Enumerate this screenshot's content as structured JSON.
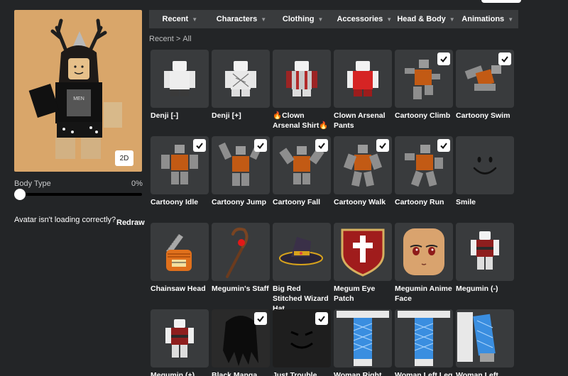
{
  "avatar": {
    "view_toggle_label": "2D",
    "body_type_label": "Body Type",
    "body_type_value": "0%",
    "body_type_fraction": 0,
    "loading_issue_text": "Avatar isn't loading correctly?",
    "redraw_label": "Redraw"
  },
  "tabs": [
    {
      "label": "Recent",
      "icon": "chevron-down-icon"
    },
    {
      "label": "Characters",
      "icon": "chevron-down-icon"
    },
    {
      "label": "Clothing",
      "icon": "chevron-down-icon"
    },
    {
      "label": "Accessories",
      "icon": "chevron-down-icon"
    },
    {
      "label": "Head & Body",
      "icon": "chevron-down-icon"
    },
    {
      "label": "Animations",
      "icon": "chevron-down-icon"
    }
  ],
  "breadcrumb": {
    "parent": "Recent",
    "separator": ">",
    "current": "All"
  },
  "items": [
    {
      "name": "Denji [-]",
      "equipped": false
    },
    {
      "name": "Denji [+]",
      "equipped": false
    },
    {
      "name": "🔥Clown Arsenal Shirt🔥",
      "equipped": false
    },
    {
      "name": "Clown Arsenal Pants",
      "equipped": false
    },
    {
      "name": "Cartoony Climb",
      "equipped": true
    },
    {
      "name": "Cartoony Swim",
      "equipped": true
    },
    {
      "name": "Cartoony Idle",
      "equipped": true
    },
    {
      "name": "Cartoony Jump",
      "equipped": true
    },
    {
      "name": "Cartoony Fall",
      "equipped": true
    },
    {
      "name": "Cartoony Walk",
      "equipped": true
    },
    {
      "name": "Cartoony Run",
      "equipped": true
    },
    {
      "name": "Smile",
      "equipped": false
    },
    {
      "name": "Chainsaw Head",
      "equipped": false
    },
    {
      "name": "Megumin's Staff",
      "equipped": false
    },
    {
      "name": "Big Red Stitched Wizard Hat",
      "equipped": false
    },
    {
      "name": "Megum Eye Patch",
      "equipped": false
    },
    {
      "name": "Megumin Anime Face",
      "equipped": false
    },
    {
      "name": "Megumin (-)",
      "equipped": false
    },
    {
      "name": "Megumin (+)",
      "equipped": false
    },
    {
      "name": "Black Manga",
      "equipped": true
    },
    {
      "name": "Just Trouble",
      "equipped": true
    },
    {
      "name": "Woman Right",
      "equipped": false
    },
    {
      "name": "Woman Left Leg",
      "equipped": false
    },
    {
      "name": "Woman Left Arm",
      "equipped": false
    }
  ],
  "colors": {
    "background": "#232527",
    "tile": "#393b3d",
    "tab_bar": "#393b3d"
  }
}
